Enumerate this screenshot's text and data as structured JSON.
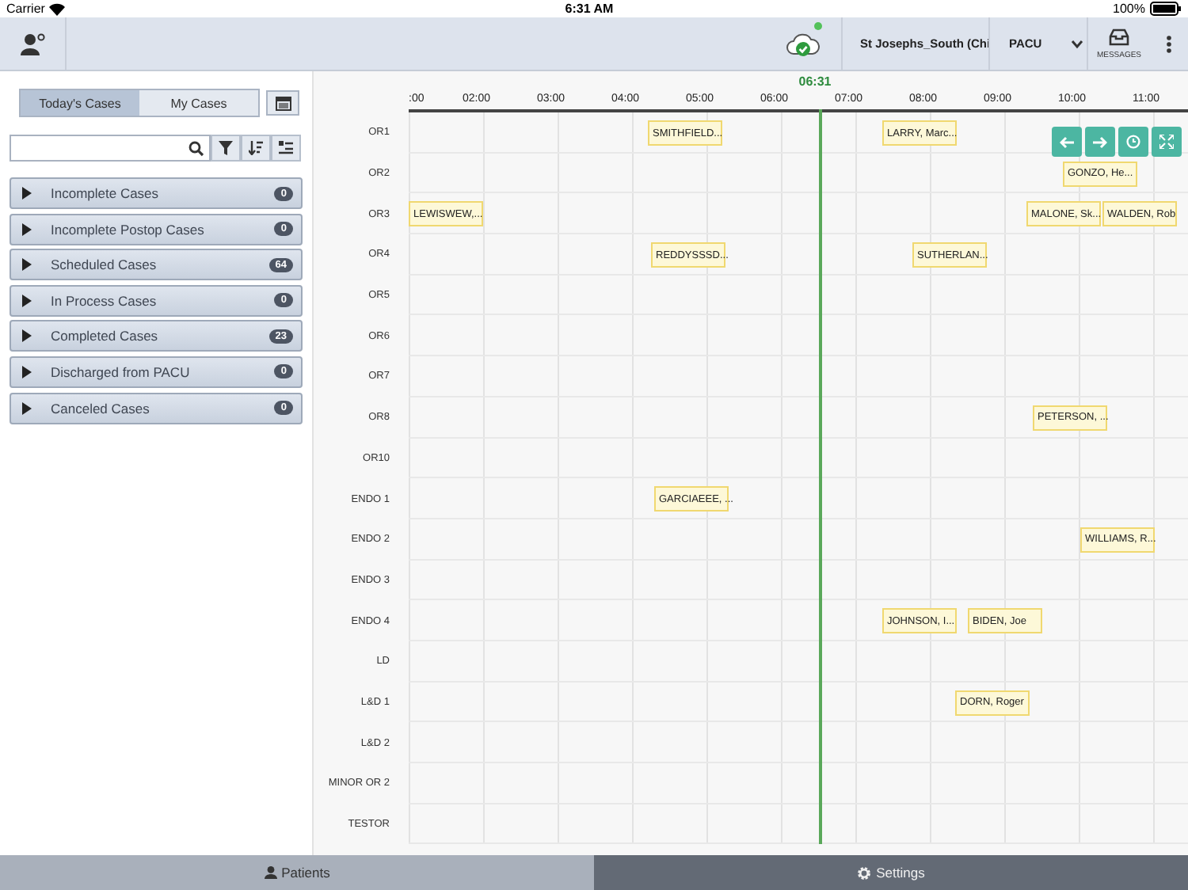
{
  "status_bar": {
    "carrier": "Carrier",
    "time": "6:31 AM",
    "battery": "100%"
  },
  "top_bar": {
    "facility": "St Josephs_South (Chi",
    "unit": "PACU",
    "messages": "MESSAGES",
    "sync_ok": true
  },
  "case_tabs": [
    {
      "label": "Today's Cases",
      "selected": true
    },
    {
      "label": "My Cases",
      "selected": false
    }
  ],
  "groups": [
    {
      "label": "Incomplete Cases",
      "count": "0",
      "expanded": false
    },
    {
      "label": "Incomplete Postop Cases",
      "count": "0",
      "expanded": false
    },
    {
      "label": "Scheduled Cases",
      "count": "64",
      "expanded": false
    },
    {
      "label": "In Process Cases",
      "count": "0",
      "expanded": false
    },
    {
      "label": "Completed Cases",
      "count": "23",
      "expanded": false
    },
    {
      "label": "Discharged from PACU",
      "count": "0",
      "expanded": false
    },
    {
      "label": "Canceled Cases",
      "count": "0",
      "expanded": false
    }
  ],
  "timeline": {
    "hours": [
      ":00",
      "02:00",
      "03:00",
      "04:00",
      "05:00",
      "06:00",
      "07:00",
      "08:00",
      "09:00",
      "10:00",
      "11:00"
    ],
    "now": "06:31",
    "rooms": [
      {
        "name": "OR1",
        "cases": [
          {
            "label": "SMITHFIELD..."
          },
          {
            "label": "LARRY, Marc..."
          }
        ]
      },
      {
        "name": "OR2",
        "cases": [
          {
            "label": "GONZO, He..."
          }
        ]
      },
      {
        "name": "OR3",
        "cases": [
          {
            "label": "LEWISWEW,..."
          },
          {
            "label": "MALONE, Sk..."
          },
          {
            "label": "WALDEN, Rob"
          }
        ]
      },
      {
        "name": "OR4",
        "cases": [
          {
            "label": "REDDYSSSD..."
          },
          {
            "label": "SUTHERLAN..."
          }
        ]
      },
      {
        "name": "OR5"
      },
      {
        "name": "OR6"
      },
      {
        "name": "OR7"
      },
      {
        "name": "OR8",
        "cases": [
          {
            "label": "PETERSON, ..."
          }
        ]
      },
      {
        "name": "OR10"
      },
      {
        "name": "ENDO 1",
        "cases": [
          {
            "label": "GARCIAEEE, ..."
          }
        ]
      },
      {
        "name": "ENDO 2",
        "cases": [
          {
            "label": "WILLIAMS, R..."
          }
        ]
      },
      {
        "name": "ENDO 3"
      },
      {
        "name": "ENDO 4",
        "cases": [
          {
            "label": "JOHNSON, I..."
          },
          {
            "label": "BIDEN, Joe"
          }
        ]
      },
      {
        "name": "LD"
      },
      {
        "name": "L&D 1",
        "cases": [
          {
            "label": "DORN, Roger"
          }
        ]
      },
      {
        "name": "L&D 2"
      },
      {
        "name": "MINOR OR 2"
      },
      {
        "name": "TESTOR"
      }
    ]
  },
  "bottom_tabs": [
    {
      "label": "Patients",
      "selected": true
    },
    {
      "label": "Settings",
      "selected": false
    }
  ]
}
